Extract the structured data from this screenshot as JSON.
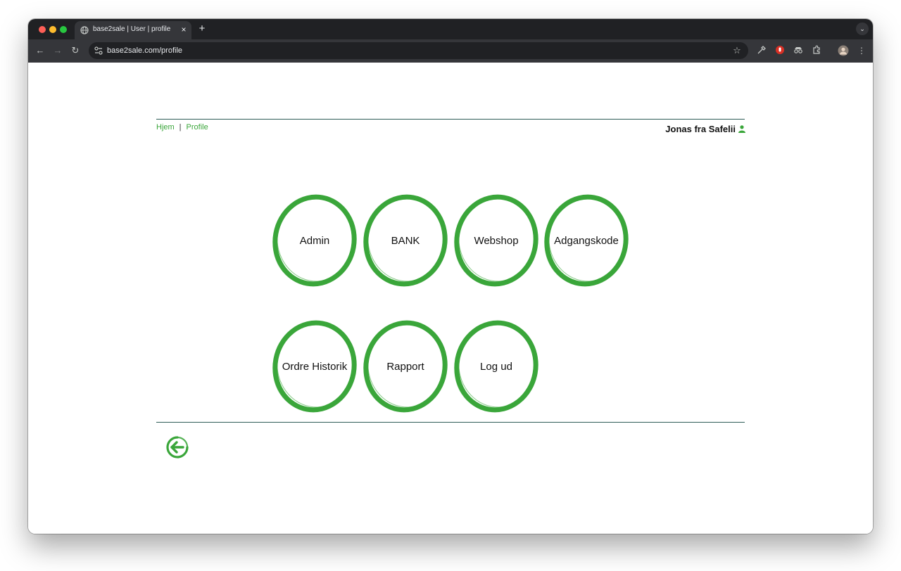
{
  "browser": {
    "tab_title": "base2sale | User | profile",
    "tab_close": "×",
    "new_tab": "+",
    "url": "base2sale.com/profile"
  },
  "breadcrumb": {
    "home": "Hjem",
    "separator": "|",
    "current": "Profile"
  },
  "user": {
    "name": "Jonas fra Safelii"
  },
  "menu": {
    "items": [
      {
        "label": "Admin"
      },
      {
        "label": "BANK"
      },
      {
        "label": "Webshop"
      },
      {
        "label": "Adgangskode"
      },
      {
        "label": "Ordre Historik"
      },
      {
        "label": "Rapport"
      },
      {
        "label": "Log ud"
      }
    ]
  },
  "colors": {
    "accent": "#3aa63a",
    "rule": "#2e5c57"
  },
  "icons": {
    "back": "arrow-left-circle-icon",
    "user": "user-icon"
  }
}
